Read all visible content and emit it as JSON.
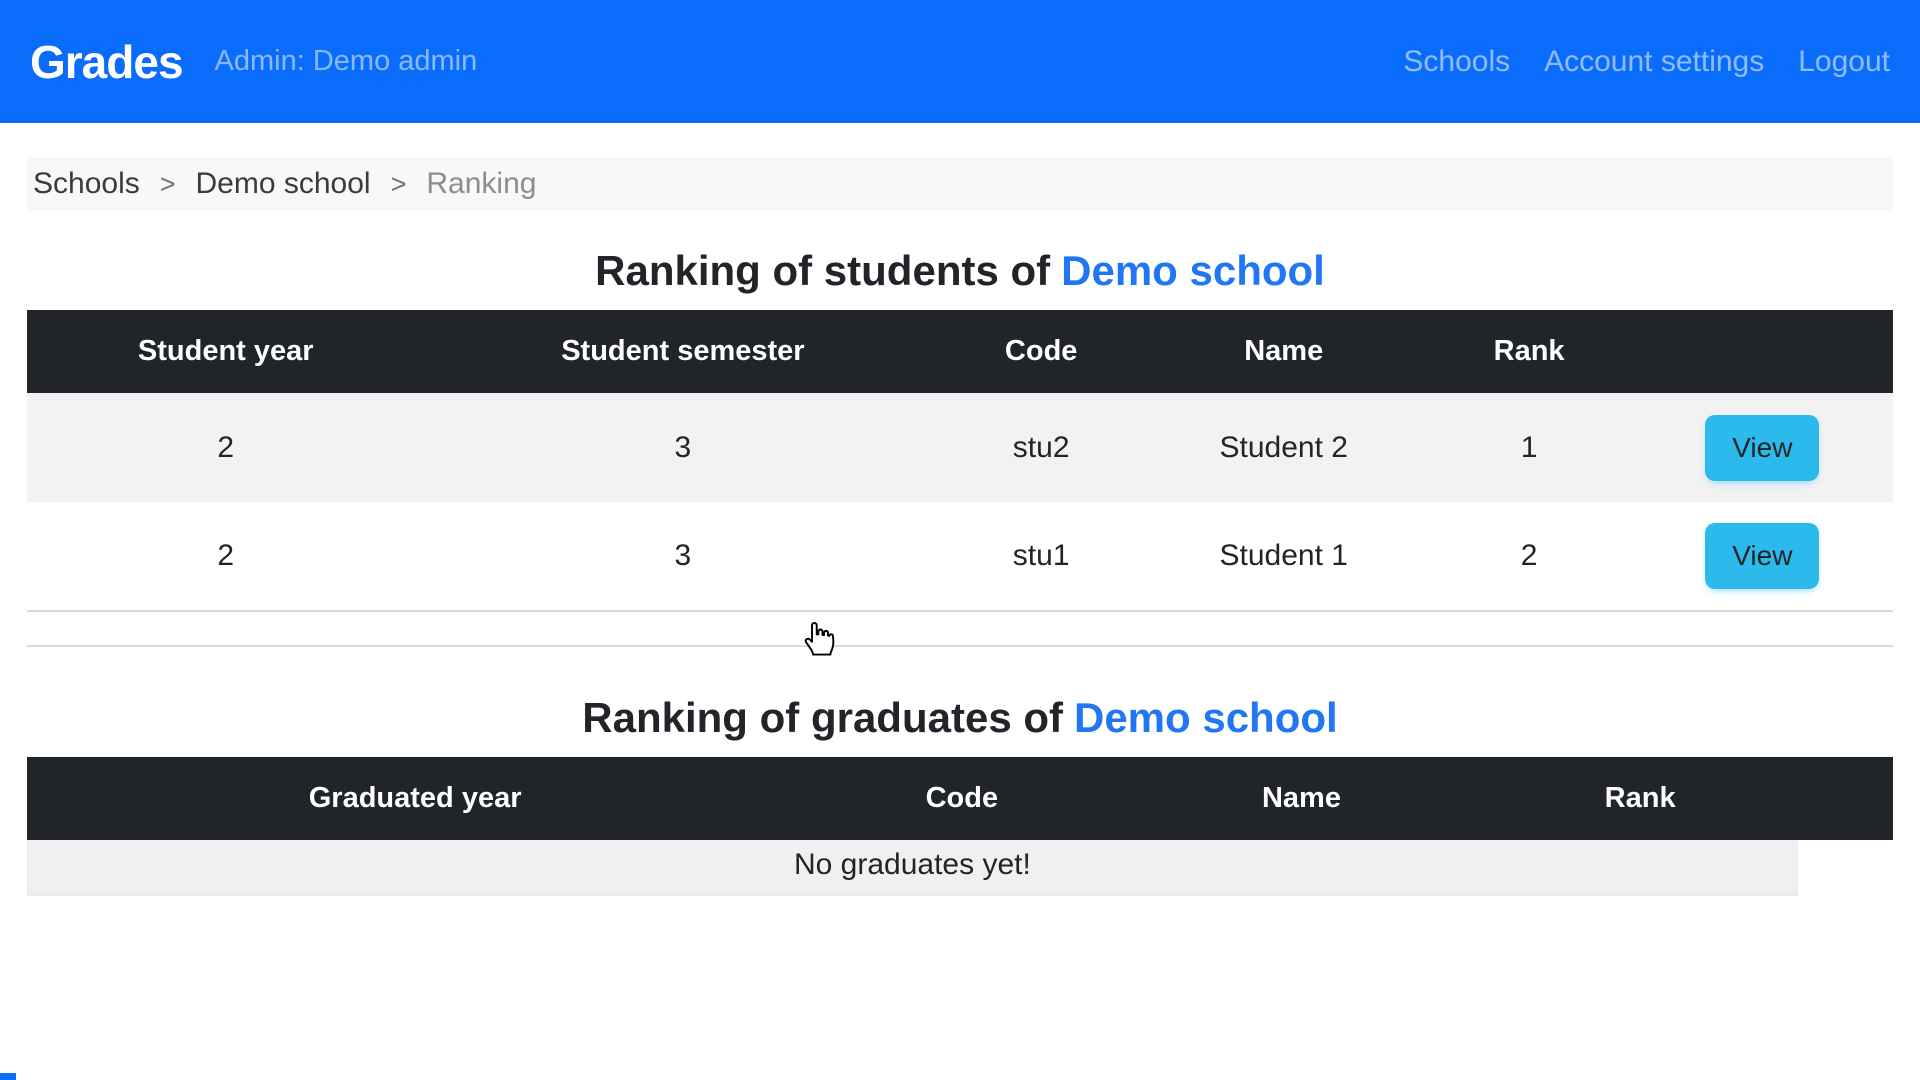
{
  "navbar": {
    "brand": "Grades",
    "admin_label": "Admin: Demo admin",
    "links": [
      "Schools",
      "Account settings",
      "Logout"
    ]
  },
  "breadcrumb": {
    "separator": ">",
    "items": [
      "Schools",
      "Demo school",
      "Ranking"
    ]
  },
  "students": {
    "title_prefix": "Ranking of students of",
    "school_name": "Demo school",
    "table": {
      "headers": [
        "Student year",
        "Student semester",
        "Code",
        "Name",
        "Rank"
      ],
      "rows": [
        [
          "2",
          "3",
          "stu2",
          "Student 2",
          "1"
        ],
        [
          "2",
          "3",
          "stu1",
          "Student 1",
          "2"
        ]
      ],
      "action_label": "View"
    }
  },
  "graduates": {
    "title_prefix": "Ranking of graduates of",
    "school_name": "Demo school",
    "table": {
      "headers": [
        "Graduated year",
        "Code",
        "Name",
        "Rank"
      ],
      "empty_message": "No graduates yet!"
    }
  },
  "colors": {
    "navbar_bg": "#0a6cfa",
    "school_link_blue": "#2176f3",
    "table_header_bg": "#212529",
    "row_stripe": "#f2f2f2",
    "empty_row_bg": "#f0f0f0",
    "view_button_bg": "#2cb9ec",
    "breadcrumb_bg": "#f8f8f8"
  }
}
